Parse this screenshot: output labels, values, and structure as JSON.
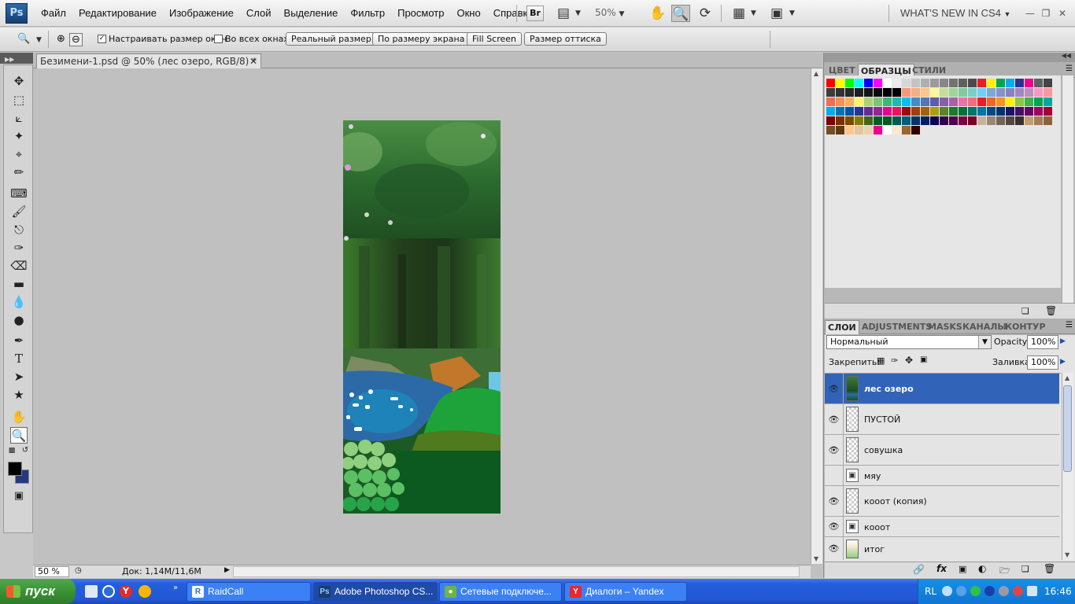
{
  "app": {
    "logo": "Ps",
    "menus": [
      "Файл",
      "Редактирование",
      "Изображение",
      "Слой",
      "Выделение",
      "Фильтр",
      "Просмотр",
      "Окно",
      "Справка"
    ],
    "bridge_label": "Br",
    "zoom_level": "50%",
    "workspace_label": "WHAT'S NEW IN CS4"
  },
  "options_bar": {
    "resize_windows": {
      "label": "Настраивать размер окон",
      "checked": true
    },
    "all_windows": {
      "label": "Во всех окнах",
      "checked": false
    },
    "buttons": [
      "Реальный размер",
      "По размеру экрана",
      "Fill Screen",
      "Размер оттиска"
    ]
  },
  "tools": [
    "move-tool",
    "marquee-tool",
    "lasso-tool",
    "magic-wand-tool",
    "crop-tool",
    "eyedropper-tool",
    "healing-brush-tool",
    "brush-tool",
    "clone-stamp-tool",
    "history-brush-tool",
    "eraser-tool",
    "gradient-tool",
    "blur-tool",
    "dodge-tool",
    "pen-tool",
    "type-tool",
    "path-selection-tool",
    "shape-tool",
    "hand-tool",
    "zoom-tool"
  ],
  "colors": {
    "foreground": "#000000",
    "background": "#25377e",
    "selected_layer": "#3163b9"
  },
  "document": {
    "tab_title": "Безимени-1.psd @ 50% (лес озеро, RGB/8) *",
    "status_zoom": "50 %",
    "status_doc": "Док: 1,14M/11,6M"
  },
  "swatches_panel": {
    "tabs": [
      "ЦВЕТ",
      "ОБРАЗЦЫ",
      "СТИЛИ"
    ],
    "active_tab": "ОБРАЗЦЫ",
    "rows": [
      [
        "#ff0000",
        "#ffff00",
        "#00ff00",
        "#00ffff",
        "#0000ff",
        "#ff00ff",
        "#ffffff",
        "#ebebeb",
        "#d7d7d7",
        "#c3c3c3",
        "#afafaf",
        "#9b9b9b",
        "#878787",
        "#737373",
        "#5f5f5f",
        "#4b4b4b",
        "#ed1c24",
        "#fff200",
        "#00a651",
        "#00aeef",
        "#2e3192",
        "#ec008c",
        "#606060",
        "#444444"
      ],
      [
        "#3c3c3c",
        "#323232",
        "#282828",
        "#1e1e1e",
        "#141414",
        "#0a0a0a",
        "#000000",
        "#000000",
        "#f7977a",
        "#f9ad81",
        "#fdc68a",
        "#fff79a",
        "#c4df9b",
        "#a3d39c",
        "#82ca9d",
        "#7bcdc8",
        "#6ecff6",
        "#7ea7d8",
        "#8493ca",
        "#8882be",
        "#a187be",
        "#bc8dbf",
        "#f49ac2",
        "#f6989d"
      ],
      [
        "#f26c4f",
        "#f68e55",
        "#fbaf5c",
        "#fff467",
        "#acd372",
        "#7cc576",
        "#3bb878",
        "#1abbb4",
        "#00bff3",
        "#438ccb",
        "#5574b9",
        "#605ca8",
        "#855fa8",
        "#a763a8",
        "#f06ea9",
        "#f26d7d",
        "#ed1c24",
        "#f26522",
        "#f7941d",
        "#fff200",
        "#8dc63f",
        "#39b54a",
        "#00a651",
        "#00a99d"
      ],
      [
        "#00aeef",
        "#0072bc",
        "#0054a6",
        "#2e3192",
        "#662d91",
        "#92278f",
        "#ec008c",
        "#ed145b",
        "#9e0b0f",
        "#a0410d",
        "#a36209",
        "#aba000",
        "#598527",
        "#1a7b30",
        "#007236",
        "#00746b",
        "#0076a3",
        "#004b80",
        "#003471",
        "#1b1464",
        "#440e62",
        "#630460",
        "#9e005d",
        "#9e0039"
      ],
      [
        "#790000",
        "#7b2e00",
        "#7d4900",
        "#827b00",
        "#406618",
        "#005e20",
        "#005826",
        "#005952",
        "#005b7f",
        "#003663",
        "#002157",
        "#0d004c",
        "#32004b",
        "#4b0049",
        "#7b0046",
        "#7a0026",
        "#c7b299",
        "#998675",
        "#736357",
        "#534741",
        "#37302d",
        "#c69c6d",
        "#a67c52",
        "#8c6239"
      ],
      [
        "#754c24",
        "#603913",
        "#fdc68a",
        "#e1c699",
        "#e8d3a9",
        "#ec008c",
        "#ffffff",
        "#ffe8d0",
        "#996633",
        "#330000"
      ]
    ]
  },
  "layers_panel": {
    "tabs": [
      "СЛОИ",
      "ADJUSTMENTS",
      "MASKS",
      "КАНАЛЫ",
      "КОНТУР"
    ],
    "active_tab": "СЛОИ",
    "blend_mode": "Нормальный",
    "opacity_label": "Opacity:",
    "opacity": "100%",
    "lock_label": "Закрепить:",
    "fill_label": "Заливка:",
    "fill": "100%",
    "layers": [
      {
        "name": "лес озеро",
        "visible": true,
        "selected": true
      },
      {
        "name": "ПУСТОЙ",
        "visible": true,
        "selected": false
      },
      {
        "name": "совушка",
        "visible": true,
        "selected": false
      },
      {
        "name": "мяу",
        "visible": false,
        "selected": false
      },
      {
        "name": "кооот (копия)",
        "visible": true,
        "selected": false
      },
      {
        "name": "кооот",
        "visible": true,
        "selected": false
      },
      {
        "name": "итог",
        "visible": true,
        "selected": false
      }
    ]
  },
  "taskbar": {
    "start_label": "пуск",
    "tasks": [
      "RaidCall",
      "Adobe Photoshop CS...",
      "Сетевые подключе...",
      "Диалоги – Yandex"
    ],
    "active_task": "Adobe Photoshop CS...",
    "language": "RL",
    "clock": "16:46"
  }
}
